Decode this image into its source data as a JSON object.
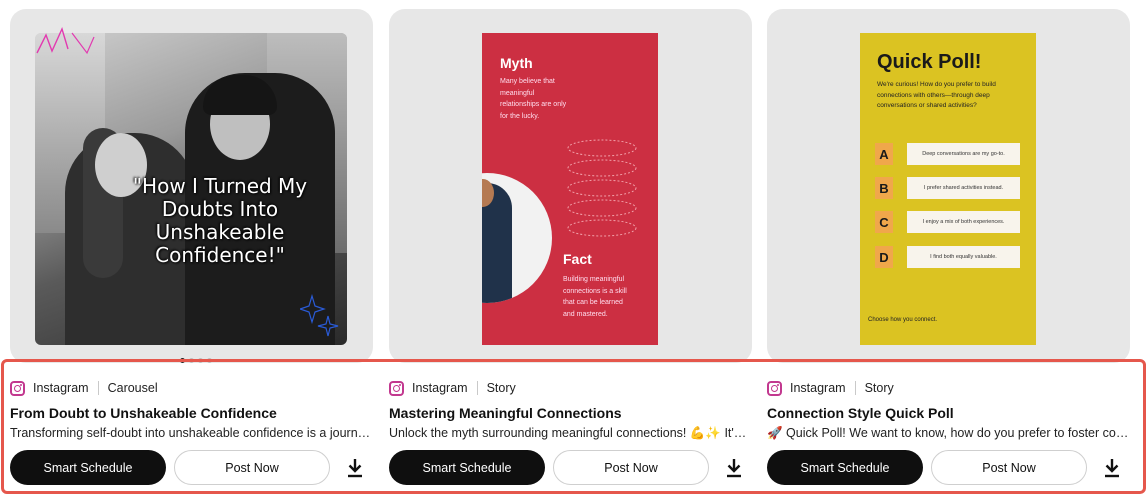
{
  "cards": [
    {
      "platform": "Instagram",
      "format": "Carousel",
      "title": "From Doubt to Unshakeable Confidence",
      "description": "Transforming self-doubt into unshakeable confidence is a journey worth taking, one small brave step at a time.",
      "primary_button": "Smart Schedule",
      "secondary_button": "Post Now",
      "preview": {
        "quote": "\"How I Turned My Doubts Into Unshakeable Confidence!\"",
        "carousel_dots": 4,
        "active_dot": 0
      }
    },
    {
      "platform": "Instagram",
      "format": "Story",
      "title": "Mastering Meaningful Connections",
      "description": "Unlock the myth surrounding meaningful connections! 💪✨ It's not just about luck, it's a skill anyone can learn.",
      "primary_button": "Smart Schedule",
      "secondary_button": "Post Now",
      "preview": {
        "myth_heading": "Myth",
        "myth_text": "Many believe that meaningful relationships are only for the lucky.",
        "fact_heading": "Fact",
        "fact_text": "Building meaningful connections is a skill that can be learned and mastered."
      }
    },
    {
      "platform": "Instagram",
      "format": "Story",
      "title": "Connection Style Quick Poll",
      "description": "🚀 Quick Poll! We want to know, how do you prefer to foster connections with others?",
      "primary_button": "Smart Schedule",
      "secondary_button": "Post Now",
      "preview": {
        "heading": "Quick Poll!",
        "question": "We're curious! How do you prefer to build connections with others—through deep conversations or shared activities?",
        "options": [
          {
            "letter": "A",
            "text": "Deep conversations are my go-to."
          },
          {
            "letter": "B",
            "text": "I prefer shared activities instead."
          },
          {
            "letter": "C",
            "text": "I enjoy a mix of both experiences."
          },
          {
            "letter": "D",
            "text": "I find both equally valuable."
          }
        ],
        "footer": "Choose how you connect."
      }
    }
  ],
  "icons": {
    "platform": "instagram-icon",
    "download": "download-icon"
  },
  "colors": {
    "highlight": "#e5574c",
    "primary_button": "#0f0f0f",
    "story_red": "#cc2f42",
    "story_yellow": "#dbc322"
  }
}
